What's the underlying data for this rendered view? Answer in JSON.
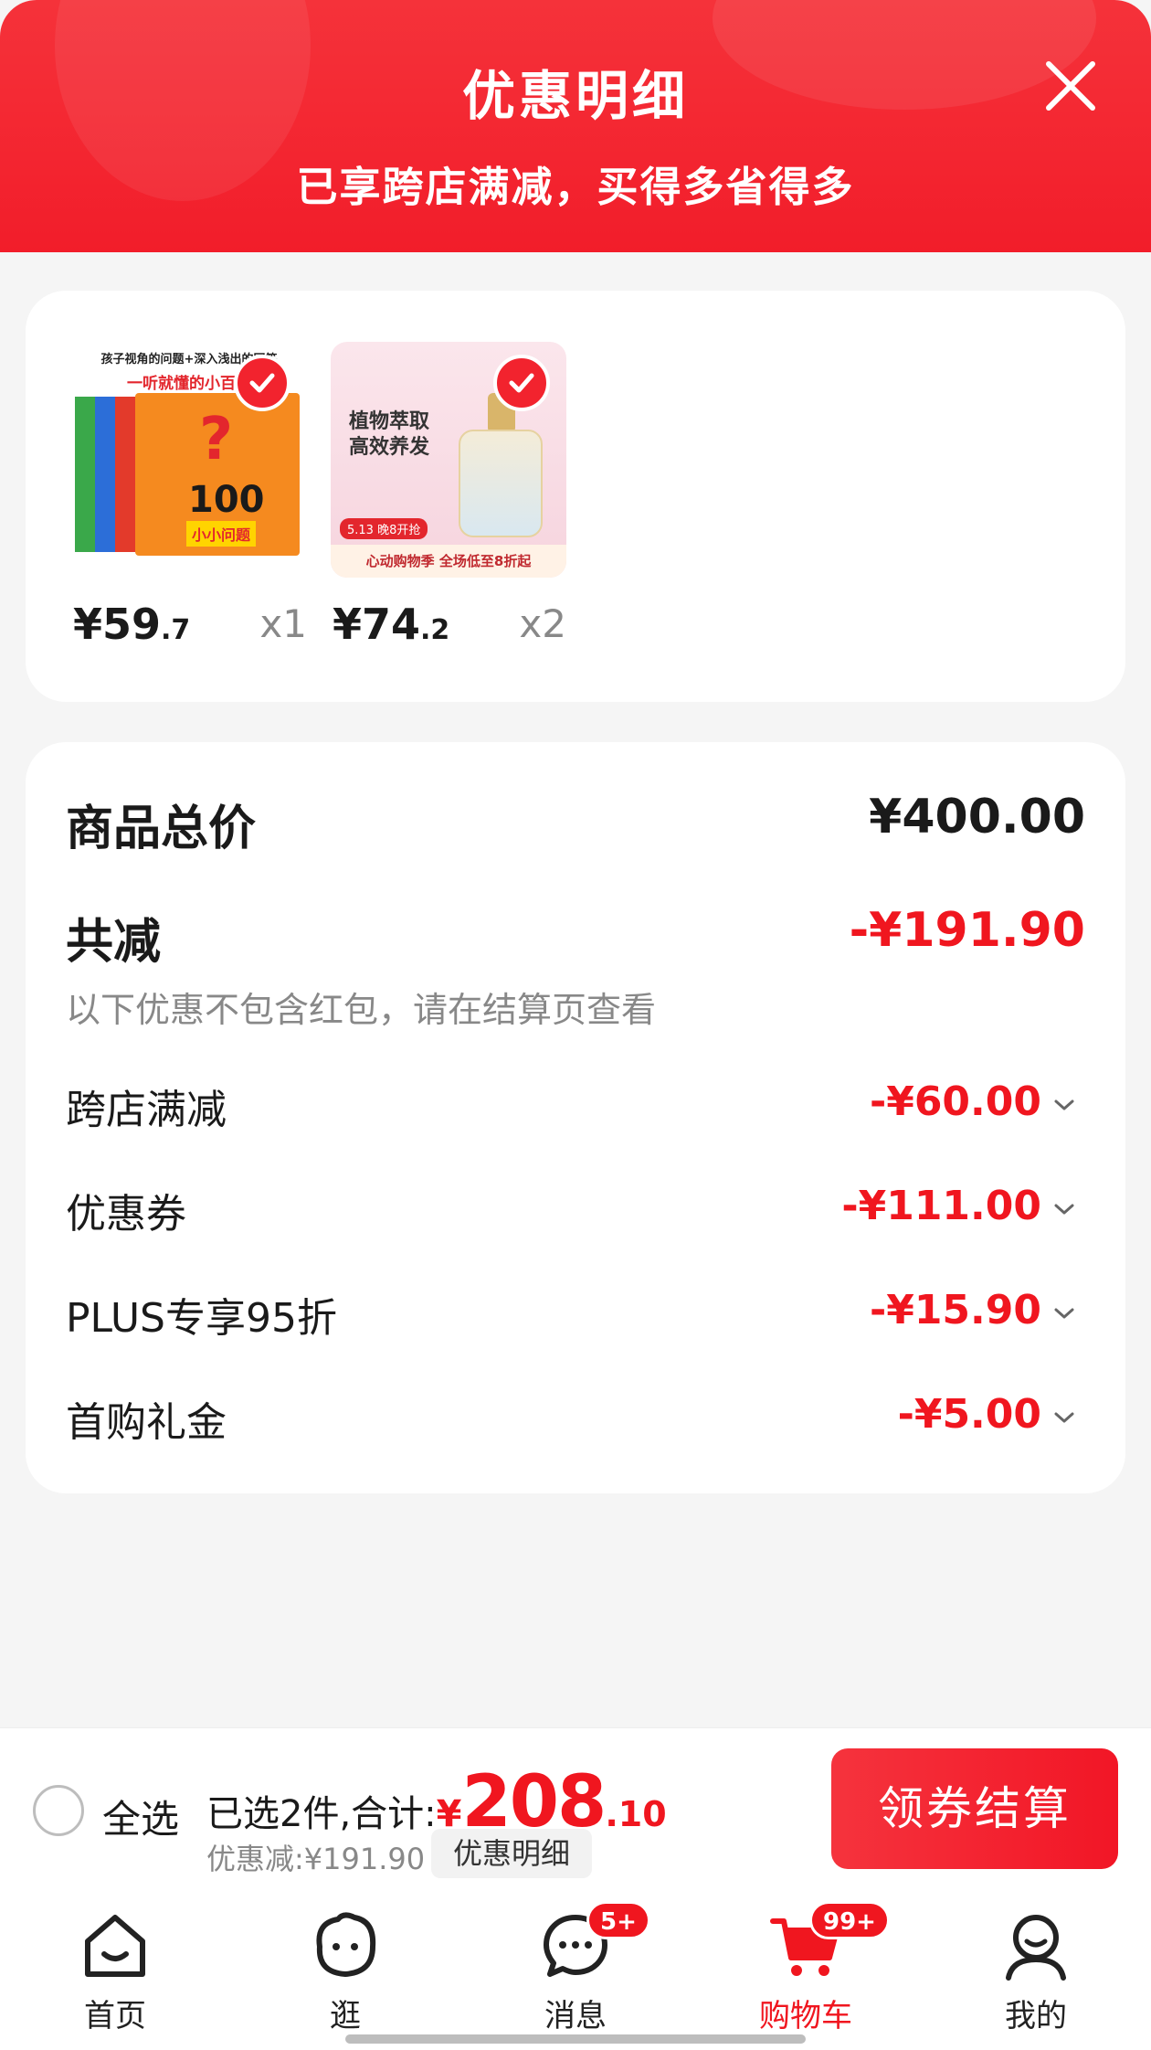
{
  "header": {
    "title": "优惠明细",
    "subtitle": "已享跨店满减，买得多省得多"
  },
  "products": [
    {
      "price_int": "¥59",
      "price_dec": ".7",
      "qty": "x1",
      "thumb": {
        "top_line": "孩子视角的问题+深入浅出的回答",
        "red_line": "一听就懂的小百科",
        "q_mark": "?",
        "title": "100",
        "tag": "小小问题"
      },
      "selected": true
    },
    {
      "price_int": "¥74",
      "price_dec": ".2",
      "qty": "x2",
      "thumb": {
        "title_line1": "植物萃取",
        "title_line2": "高效养发",
        "pill": "5.13 晚8开抢",
        "band": "心动购物季  全场低至8折起"
      },
      "selected": true
    }
  ],
  "summary": {
    "total_label": "商品总价",
    "total_value": "¥400.00",
    "reduce_label": "共减",
    "reduce_value": "-¥191.90",
    "note": "以下优惠不包含红包，请在结算页查看",
    "discounts": [
      {
        "label": "跨店满减",
        "value": "-¥60.00"
      },
      {
        "label": "优惠券",
        "value": "-¥111.00"
      },
      {
        "label": "PLUS专享95折",
        "value": "-¥15.90"
      },
      {
        "label": "首购礼金",
        "value": "-¥5.00"
      }
    ]
  },
  "checkout": {
    "select_all": "全选",
    "sum_prefix": "已选2件,合计:",
    "yen": "¥",
    "amount_int": "208",
    "amount_dec": ".10",
    "discount_text": "优惠减:¥191.90",
    "detail_button": "优惠明细",
    "checkout_button": "领券结算"
  },
  "tabbar": {
    "tabs": [
      {
        "label": "首页",
        "icon": "home-icon"
      },
      {
        "label": "逛",
        "icon": "browse-icon"
      },
      {
        "label": "消息",
        "icon": "message-icon",
        "badge": "5+"
      },
      {
        "label": "购物车",
        "icon": "cart-icon",
        "badge": "99+",
        "active": true
      },
      {
        "label": "我的",
        "icon": "profile-icon"
      }
    ]
  },
  "colors": {
    "accent": "#f0161f",
    "header": "#f21d2a"
  }
}
